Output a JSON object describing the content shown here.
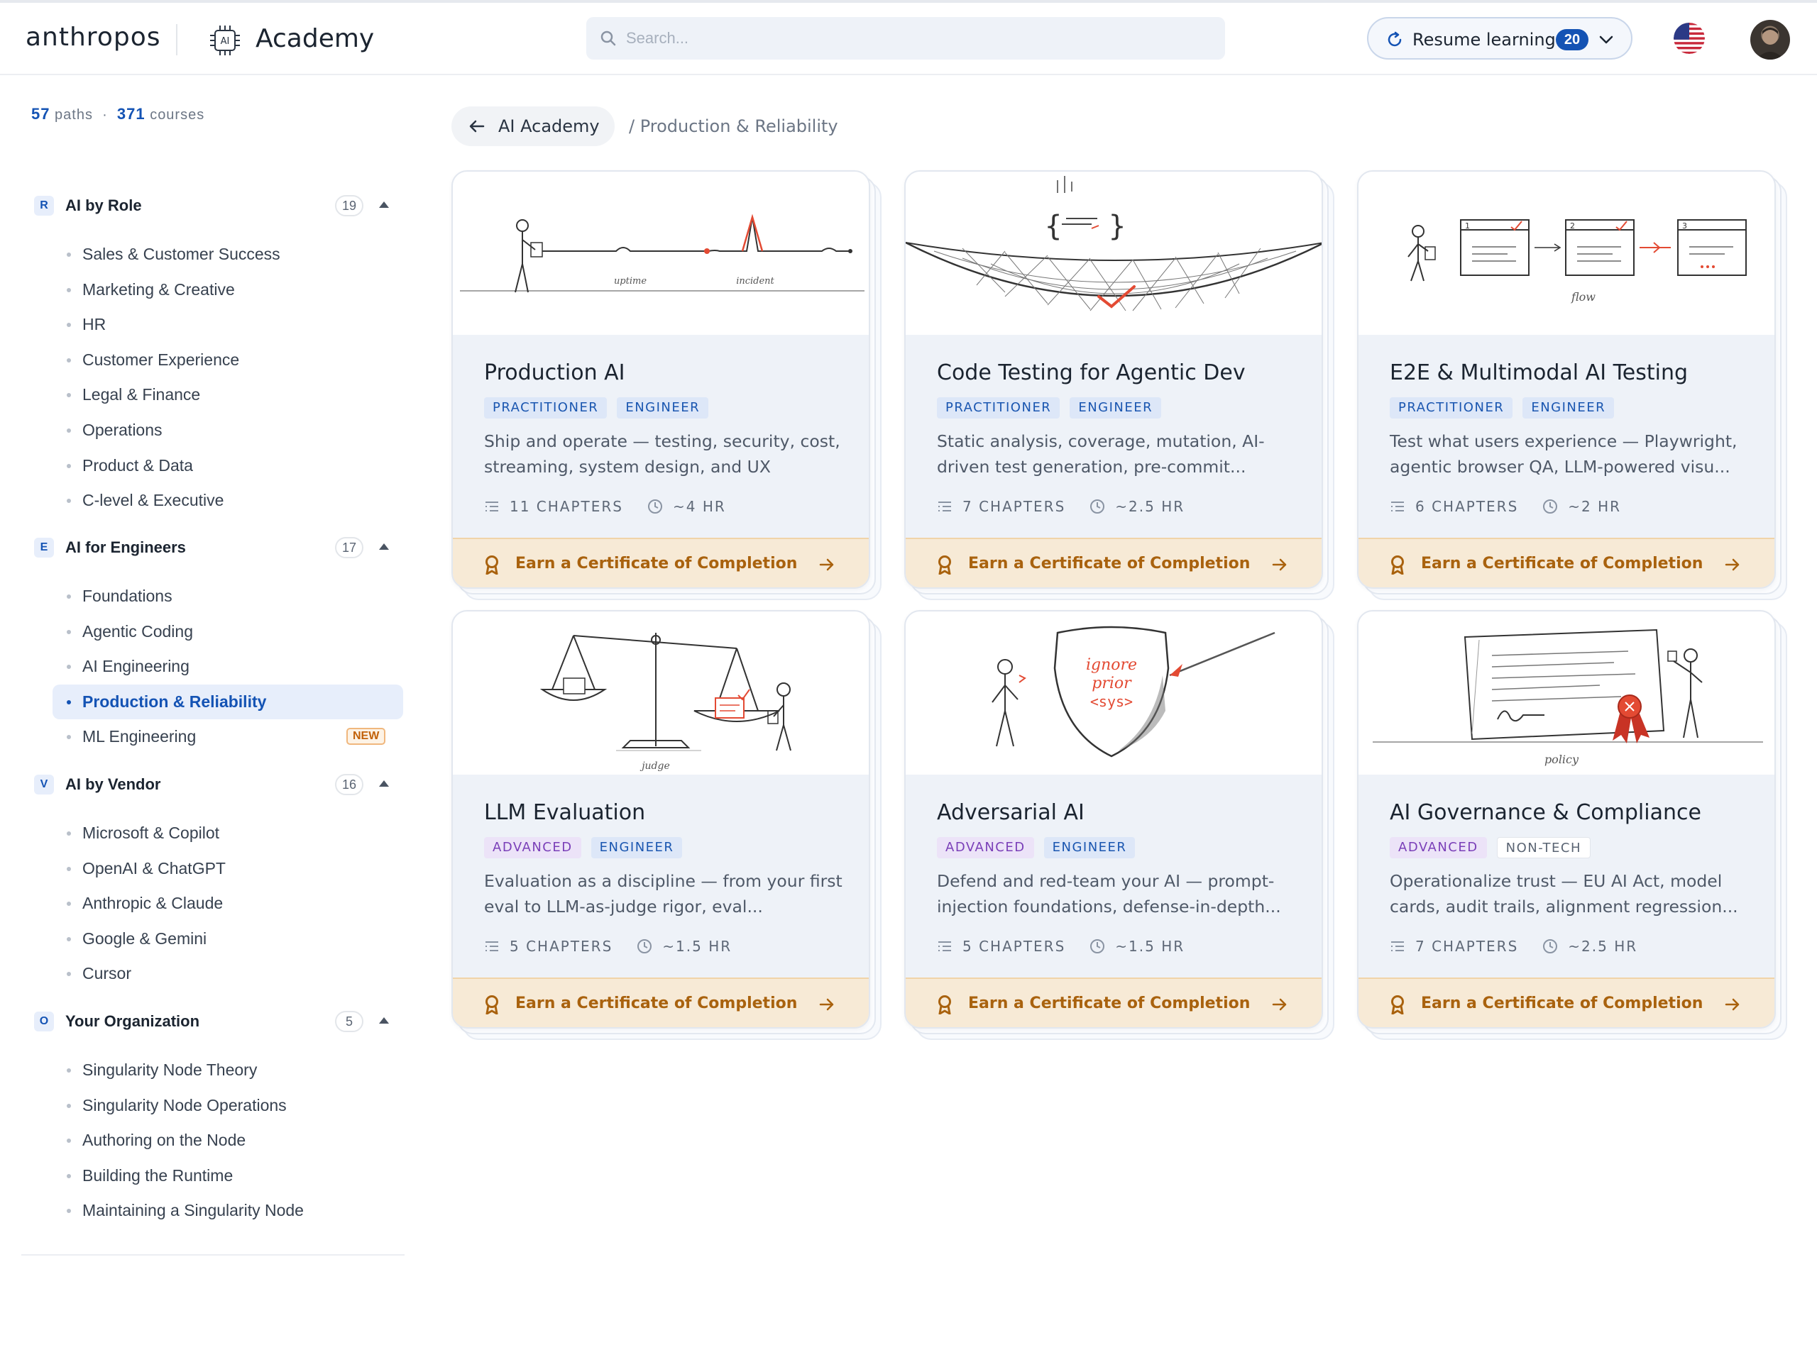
{
  "header": {
    "brand": "anthropos",
    "app_title": "Academy",
    "academy_icon_label": "AI",
    "search_placeholder": "Search...",
    "resume_label": "Resume learning",
    "resume_count": "20"
  },
  "sidebar": {
    "stats": {
      "paths": "57",
      "paths_label": "paths",
      "courses": "371",
      "courses_label": "courses",
      "separator": "·"
    },
    "groups": [
      {
        "letter": "R",
        "title": "AI by Role",
        "count": "19",
        "items": [
          "Sales & Customer Success",
          "Marketing & Creative",
          "HR",
          "Customer Experience",
          "Legal & Finance",
          "Operations",
          "Product & Data",
          "C-level & Executive"
        ]
      },
      {
        "letter": "E",
        "title": "AI for Engineers",
        "count": "17",
        "items": [
          "Foundations",
          "Agentic Coding",
          "AI Engineering",
          "Production & Reliability",
          "ML Engineering"
        ],
        "active_index": 3,
        "new_badge_index": 4,
        "new_badge": "NEW"
      },
      {
        "letter": "V",
        "title": "AI by Vendor",
        "count": "16",
        "items": [
          "Microsoft & Copilot",
          "OpenAI & ChatGPT",
          "Anthropic & Claude",
          "Google & Gemini",
          "Cursor"
        ]
      },
      {
        "letter": "O",
        "title": "Your Organization",
        "count": "5",
        "items": [
          "Singularity Node Theory",
          "Singularity Node Operations",
          "Authoring on the Node",
          "Building the Runtime",
          "Maintaining a Singularity Node"
        ]
      }
    ]
  },
  "breadcrumb": {
    "back_label": "AI Academy",
    "current": "/ Production & Reliability"
  },
  "cards": [
    {
      "title": "Production AI",
      "tags": [
        {
          "label": "PRACTITIONER",
          "style": "blue"
        },
        {
          "label": "ENGINEER",
          "style": "blue"
        }
      ],
      "description": "Ship and operate — testing, security, cost, streaming, system design, and UX",
      "chapters": "11 CHAPTERS",
      "duration": "~4 HR",
      "cert": "Earn a Certificate of Completion",
      "illus_labels": [
        "uptime",
        "incident"
      ]
    },
    {
      "title": "Code Testing for Agentic Dev",
      "tags": [
        {
          "label": "PRACTITIONER",
          "style": "blue"
        },
        {
          "label": "ENGINEER",
          "style": "blue"
        }
      ],
      "description": "Static analysis, coverage, mutation, AI-driven test generation, pre-commit...",
      "chapters": "7 CHAPTERS",
      "duration": "~2.5 HR",
      "cert": "Earn a Certificate of Completion",
      "illus_labels": [
        "{",
        "}"
      ]
    },
    {
      "title": "E2E & Multimodal AI Testing",
      "tags": [
        {
          "label": "PRACTITIONER",
          "style": "blue"
        },
        {
          "label": "ENGINEER",
          "style": "blue"
        }
      ],
      "description": "Test what users experience — Playwright, agentic browser QA, LLM-powered visu...",
      "chapters": "6 CHAPTERS",
      "duration": "~2 HR",
      "cert": "Earn a Certificate of Completion",
      "illus_labels": [
        "flow",
        "1",
        "2",
        "3"
      ]
    },
    {
      "title": "LLM Evaluation",
      "tags": [
        {
          "label": "ADVANCED",
          "style": "purple"
        },
        {
          "label": "ENGINEER",
          "style": "blue"
        }
      ],
      "description": "Evaluation as a discipline — from your first eval to LLM-as-judge rigor, eval...",
      "chapters": "5 CHAPTERS",
      "duration": "~1.5 HR",
      "cert": "Earn a Certificate of Completion",
      "illus_labels": [
        "judge"
      ]
    },
    {
      "title": "Adversarial AI",
      "tags": [
        {
          "label": "ADVANCED",
          "style": "purple"
        },
        {
          "label": "ENGINEER",
          "style": "blue"
        }
      ],
      "description": "Defend and red-team your AI — prompt-injection foundations, defense-in-depth...",
      "chapters": "5 CHAPTERS",
      "duration": "~1.5 HR",
      "cert": "Earn a Certificate of Completion",
      "illus_labels": [
        "ignore",
        "prior",
        "<sys>"
      ]
    },
    {
      "title": "AI Governance & Compliance",
      "tags": [
        {
          "label": "ADVANCED",
          "style": "purple"
        },
        {
          "label": "NON-TECH",
          "style": "gray"
        }
      ],
      "description": "Operationalize trust — EU AI Act, model cards, audit trails, alignment regression...",
      "chapters": "7 CHAPTERS",
      "duration": "~2.5 HR",
      "cert": "Earn a Certificate of Completion",
      "illus_labels": [
        "policy"
      ]
    }
  ],
  "colors": {
    "accent": "#1453b4",
    "cert_bg": "#f7ead6",
    "cert_text": "#a9620e",
    "new_badge": "#c2620a"
  }
}
